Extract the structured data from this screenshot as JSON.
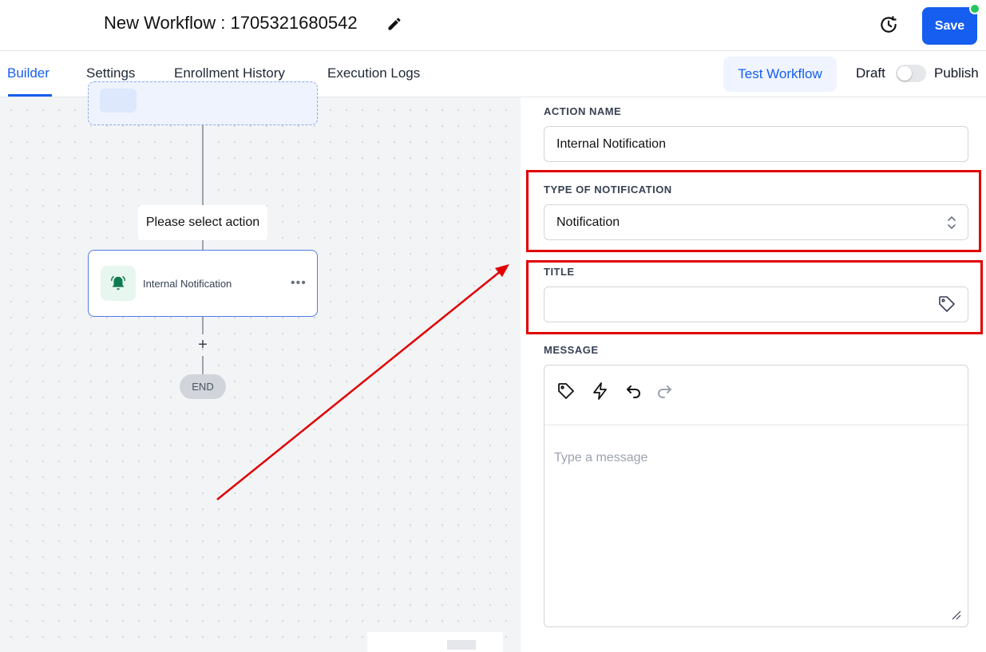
{
  "header": {
    "workflow_title": "New Workflow : 1705321680542",
    "save_label": "Save"
  },
  "tabs": [
    {
      "label": "Builder",
      "active": true
    },
    {
      "label": "Settings",
      "active": false
    },
    {
      "label": "Enrollment History",
      "active": false
    },
    {
      "label": "Execution Logs",
      "active": false
    }
  ],
  "toolbar": {
    "test_workflow_label": "Test Workflow",
    "draft_label": "Draft",
    "publish_label": "Publish",
    "publish_toggle_on": false
  },
  "canvas": {
    "select_action_label": "Please select action",
    "action_node_label": "Internal Notification",
    "plus_label": "+",
    "end_label": "END"
  },
  "panel": {
    "action_name": {
      "label": "ACTION NAME",
      "value": "Internal Notification"
    },
    "type_of_notification": {
      "label": "TYPE OF NOTIFICATION",
      "value": "Notification"
    },
    "title": {
      "label": "TITLE",
      "value": ""
    },
    "message": {
      "label": "MESSAGE",
      "placeholder": "Type a message"
    }
  },
  "colors": {
    "accent": "#155eef",
    "status_dot": "#22c55e",
    "annotation_red": "#e00000",
    "bell_green": "#0f7a4f"
  }
}
